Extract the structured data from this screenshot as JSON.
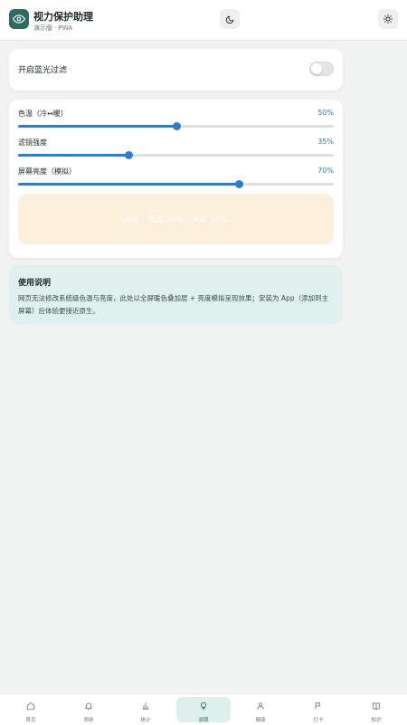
{
  "header": {
    "title": "视力保护助理",
    "subtitle": "演示版 · PWA",
    "app_icon": "eye-icon",
    "theme_icon": "moon-icon",
    "settings_icon": "sun-icon"
  },
  "toggle": {
    "label": "开启蓝光过滤",
    "on": false
  },
  "sliders": [
    {
      "label": "色温（冷↔暖）",
      "value_text": "50%",
      "value": 0.5
    },
    {
      "label": "滤镜强度",
      "value_text": "35%",
      "value": 0.35
    },
    {
      "label": "屏幕亮度（模拟）",
      "value_text": "70%",
      "value": 0.7
    }
  ],
  "preview": {
    "text": "暖色 · 强度 35% · 亮度 70%"
  },
  "info": {
    "title": "使用说明",
    "text": "网页无法修改系统级色温与亮度，此处以全屏暖色叠加层 + 亮度模拟呈现效果；安装为 App（添加到主屏幕）后体验更接近原生。"
  },
  "nav": [
    {
      "label": "首页",
      "icon": "home-icon"
    },
    {
      "label": "闹钟",
      "icon": "bell-icon"
    },
    {
      "label": "统计",
      "icon": "bar-chart-icon"
    },
    {
      "label": "滤镜",
      "icon": "bulb-icon",
      "active": true
    },
    {
      "label": "健康",
      "icon": "person-icon"
    },
    {
      "label": "打卡",
      "icon": "flag-icon"
    },
    {
      "label": "知识",
      "icon": "book-icon"
    }
  ],
  "colors": {
    "accent": "#2a7fd1",
    "brand": "#2f6b63",
    "info_bg": "#e0f0ee",
    "preview_bg": "#fcefdc"
  }
}
